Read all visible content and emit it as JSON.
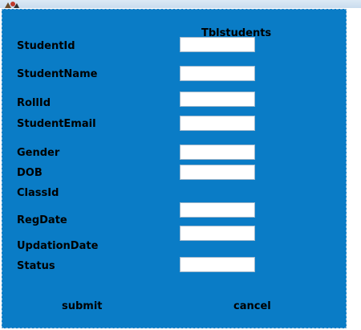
{
  "form": {
    "title": "Tblstudents",
    "labels": {
      "student_id": "StudentId",
      "student_name": "StudentName",
      "roll_id": "RollId",
      "student_email": "StudentEmail",
      "gender": "Gender",
      "dob": "DOB",
      "class_id": "ClassId",
      "reg_date": "RegDate",
      "updation_date": "UpdationDate",
      "status": "Status"
    },
    "values": {
      "student_id": "",
      "student_name": "",
      "roll_id": "",
      "student_email": "",
      "gender": "",
      "dob": "",
      "class_id": "",
      "reg_date": "",
      "status": ""
    },
    "buttons": {
      "submit": "submit",
      "cancel": "cancel"
    }
  },
  "colors": {
    "panel_bg": "#0a7cc6",
    "field_bg": "#ffffff",
    "text": "#000000"
  }
}
